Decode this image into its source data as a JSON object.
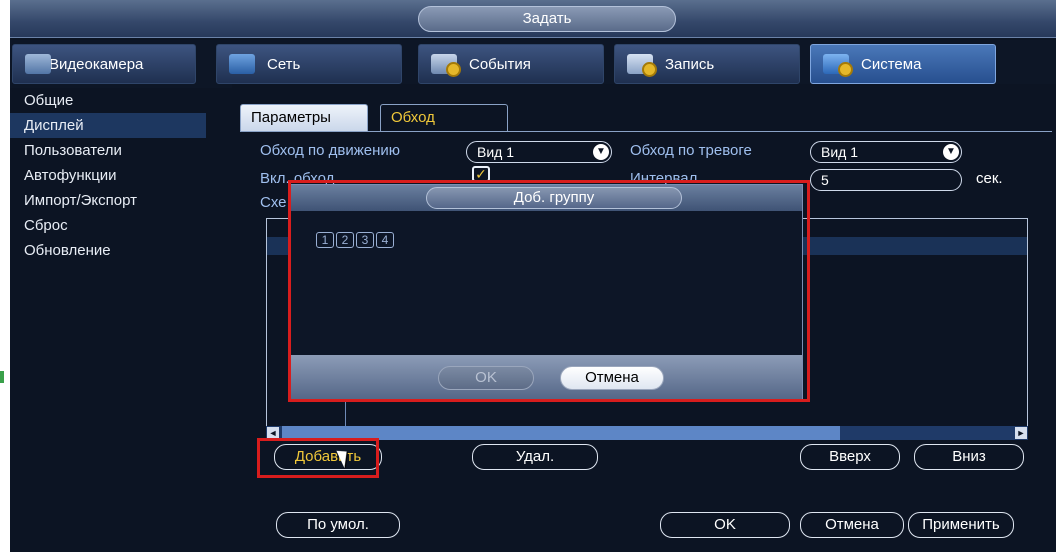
{
  "window": {
    "title": "Задать"
  },
  "tabs": [
    {
      "label": "Видеокамера",
      "icon": "camera-icon"
    },
    {
      "label": "Сеть",
      "icon": "network-icon"
    },
    {
      "label": "События",
      "icon": "events-icon"
    },
    {
      "label": "Запись",
      "icon": "record-icon"
    },
    {
      "label": "Система",
      "icon": "system-icon",
      "active": true
    }
  ],
  "sidebar": {
    "items": [
      {
        "label": "Общие"
      },
      {
        "label": "Дисплей",
        "active": true
      },
      {
        "label": "Пользователи"
      },
      {
        "label": "Автофункции"
      },
      {
        "label": "Импорт/Экспорт"
      },
      {
        "label": "Сброс"
      },
      {
        "label": "Обновление"
      }
    ]
  },
  "subtabs": {
    "params": "Параметры",
    "tour": "Обход"
  },
  "form": {
    "motion_tour_label": "Обход по движению",
    "motion_tour_value": "Вид 1",
    "alarm_tour_label": "Обход по тревоге",
    "alarm_tour_value": "Вид 1",
    "enable_tour_label": "Вкл. обход",
    "enable_tour_checked": true,
    "interval_label": "Интервал",
    "interval_value": "5",
    "interval_unit": "сек.",
    "scheme_label_partial": "Схе"
  },
  "buttons": {
    "add": "Добавить",
    "delete": "Удал.",
    "up": "Вверх",
    "down": "Вниз",
    "default": "По умол.",
    "ok": "OK",
    "cancel": "Отмена",
    "apply": "Применить"
  },
  "dialog": {
    "title": "Доб. группу",
    "groups": [
      "1",
      "2",
      "3",
      "4"
    ],
    "ok": "OK",
    "cancel": "Отмена"
  },
  "colors": {
    "background": "#0c1423",
    "accent_yellow": "#f0c83a",
    "label_blue": "#9fbfee",
    "highlight_red": "#d81d1d"
  }
}
